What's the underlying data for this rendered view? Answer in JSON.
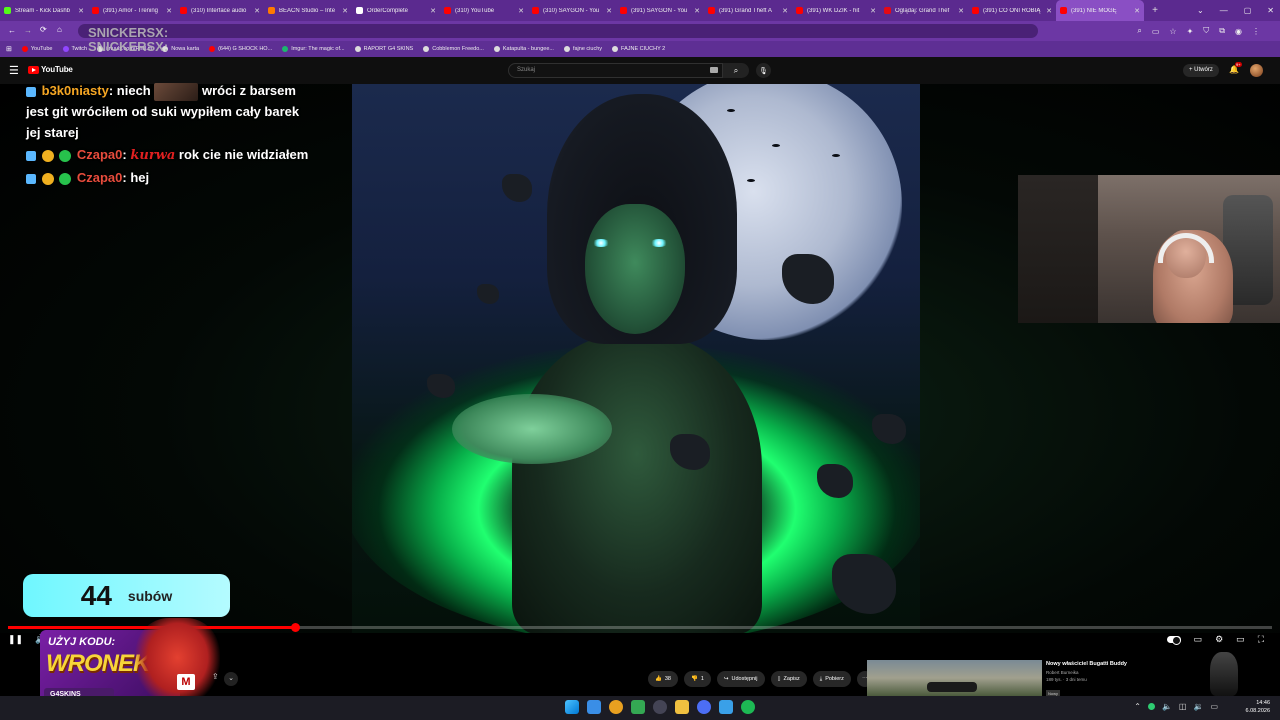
{
  "browser": {
    "tabs": [
      {
        "label": "Stream - Kick Dashb",
        "color": "#53fc18",
        "active": false
      },
      {
        "label": "(391) Amor - Trening",
        "color": "#ff0000",
        "active": false
      },
      {
        "label": "(310) Interface audio",
        "color": "#ff0000",
        "active": false
      },
      {
        "label": "BEACN Studio – Inte",
        "color": "#ff7a00",
        "active": false
      },
      {
        "label": "OrderComplete",
        "color": "#ffffff",
        "active": false
      },
      {
        "label": "(310) YouTube",
        "color": "#ff0000",
        "active": false
      },
      {
        "label": "(310) SAYGON - You",
        "color": "#ff0000",
        "active": false
      },
      {
        "label": "(391) SAYGON - You",
        "color": "#ff0000",
        "active": false
      },
      {
        "label": "(391) Grand Theft A",
        "color": "#ff0000",
        "active": false
      },
      {
        "label": "(391) WK DZIK - hit",
        "color": "#ff0000",
        "active": false
      },
      {
        "label": "Oglądaj: Grand Thef",
        "color": "#e50914",
        "active": false
      },
      {
        "label": "(391) CO ONI ROBIĄ",
        "color": "#ff0000",
        "active": false
      },
      {
        "label": "(391) NIE MOGĘ",
        "color": "#ff0000",
        "active": true
      }
    ],
    "new_tab": "+",
    "bookmarks": [
      {
        "label": "YouTube",
        "color": "#ff0000"
      },
      {
        "label": "Twitch",
        "color": "#9146ff"
      },
      {
        "label": "i.nuuls.com/Rhlil.m",
        "color": "#dddddd"
      },
      {
        "label": "Nowa karta",
        "color": "#dddddd"
      },
      {
        "label": "(644) G SHOCK HO...",
        "color": "#ff0000"
      },
      {
        "label": "Imgur: The magic of...",
        "color": "#1bb76e"
      },
      {
        "label": "RAPORT G4 SKINS",
        "color": "#dddddd"
      },
      {
        "label": "Cobblemon Freedo...",
        "color": "#dddddd"
      },
      {
        "label": "Katapulta - bungee...",
        "color": "#dddddd"
      },
      {
        "label": "fajne ciuchy",
        "color": "#dddddd"
      },
      {
        "label": "FAJNE CIUCHY 2",
        "color": "#dddddd"
      }
    ]
  },
  "youtube": {
    "logo": "YouTube",
    "search_placeholder": "Szukaj",
    "create_label": "Utwórz",
    "notif_count": "9+"
  },
  "overlay": {
    "top_user_ghost_1": "SNICKERSX:",
    "top_user_ghost_2": "SNICKERSX:",
    "chat": [
      {
        "user": "b3k0niasty",
        "user_color": "#f5a623",
        "pre": "niech",
        "post": "wróci z barsem jest git wróciłem od suki wypiłem cały barek jej starej"
      },
      {
        "user": "Czapa0",
        "user_color": "#e74c3c",
        "emote": "kurwa",
        "post": "rok cie nie widziałem"
      },
      {
        "user": "Czapa0",
        "user_color": "#e74c3c",
        "post": "hej"
      }
    ],
    "subs": {
      "count": "44",
      "label": "subów"
    },
    "promo": {
      "line1": "UŻYJ KODU:",
      "line2": "WRONEK",
      "brand": "G4SKINS",
      "badge": "M"
    }
  },
  "player": {
    "progress_fraction": 0.227
  },
  "actions": {
    "likes": "38",
    "dislikes": "1",
    "share": "Udostępnij",
    "save": "Zapisz",
    "download": "Pobierz"
  },
  "recommended": {
    "title": "Nowy właściciel Bugatti Buddy",
    "channel": "Robert Burneika",
    "stats": "189 tys. · 3 dni temu",
    "badge": "Nowy"
  },
  "taskbar": {
    "time": "14:46",
    "date": "6.08.2026",
    "apps": [
      "#3a8ee6",
      "#e8a020",
      "#34a853",
      "#444455",
      "#f0c040",
      "#4c6ef5",
      "#3aa0e8",
      "#1db954"
    ]
  }
}
